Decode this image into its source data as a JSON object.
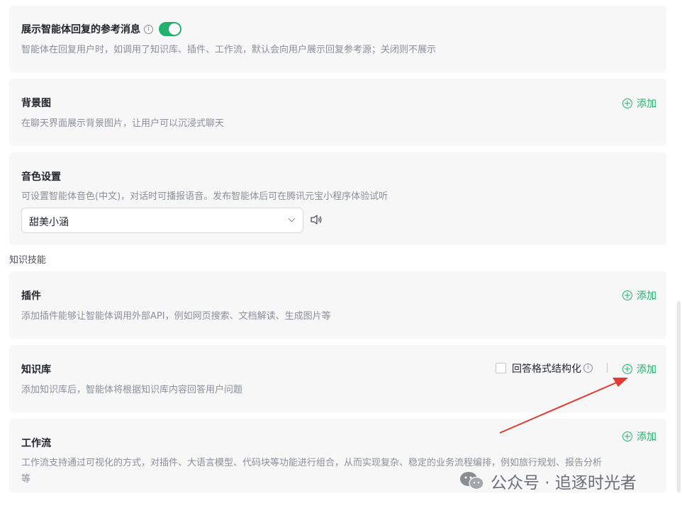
{
  "reference_msg": {
    "title": "展示智能体回复的参考消息",
    "desc": "智能体在回复用户时，如调用了知识库、插件、工作流，默认会向用户展示回复参考源；关闭则不展示",
    "toggle_on": true
  },
  "background": {
    "title": "背景图",
    "desc": "在聊天界面展示背景图片，让用户可以沉浸式聊天",
    "add_label": "添加"
  },
  "voice": {
    "title": "音色设置",
    "desc": "可设置智能体音色(中文)，对话时可播报语音。发布智能体后可在腾讯元宝小程序体验试听",
    "selected": "甜美小涵"
  },
  "section_label": "知识技能",
  "plugins": {
    "title": "插件",
    "desc": "添加插件能够让智能体调用外部API，例如网页搜索、文档解读、生成图片等",
    "add_label": "添加"
  },
  "knowledge": {
    "title": "知识库",
    "desc": "添加知识库后，智能体将根据知识库内容回答用户问题",
    "checkbox_label": "回答格式结构化",
    "add_label": "添加"
  },
  "workflow": {
    "title": "工作流",
    "desc_line1": "工作流支持通过可视化的方式，对插件、大语言模型、代码块等功能进行组合，从而实现复杂、稳定的业务流程编排，例如旅行规划、报告分析",
    "desc_line2": "等",
    "add_label": "添加"
  },
  "watermark": "公众号 · 追逐时光者",
  "colors": {
    "accent": "#23b26d",
    "arrow": "#e53a2f"
  }
}
